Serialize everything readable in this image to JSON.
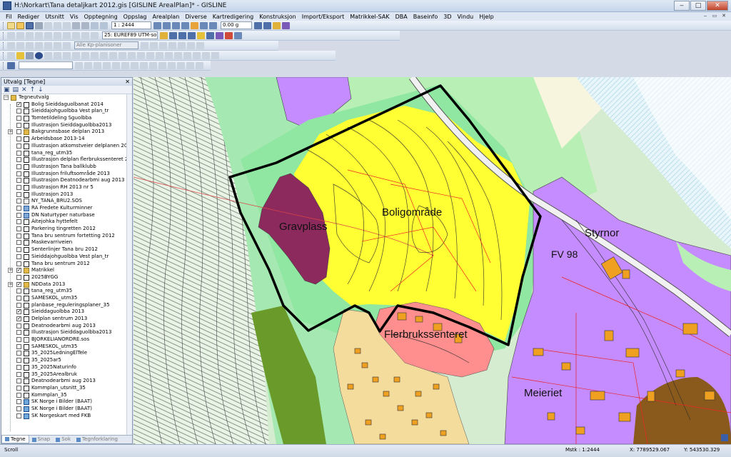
{
  "window": {
    "title": "H:\\Norkart\\Tana detaljkart 2012.gis [GISLINE ArealPlan]* - GISLINE",
    "minimize": "‒",
    "maximize": "□",
    "close": "✕"
  },
  "menu": [
    "Fil",
    "Rediger",
    "Utsnitt",
    "Vis",
    "Opptegning",
    "Oppslag",
    "Arealplan",
    "Diverse",
    "Kartredigering",
    "Konstruksjon",
    "Import/Eksport",
    "Matrikkel-SAK",
    "DBA",
    "Baseinfo",
    "3D",
    "Vindu",
    "Hjelp"
  ],
  "toolbar": {
    "scale": "1 : 2444",
    "coord_system": "25: EUREF89 UTM-sone 35",
    "height_value": "0.00 g",
    "kp_filter": "Alle Kp-planisoner"
  },
  "panel": {
    "title": "Utvalg [Tegne]",
    "close": "✕",
    "root": "Tegneutvalg",
    "layers": [
      {
        "label": "Bolig Sieiddaguolbanat 2014",
        "checked": true,
        "expand": false,
        "icon": "db"
      },
      {
        "label": "Sieiddajohguolbba Vest plan_tr",
        "checked": false,
        "expand": false,
        "icon": "db"
      },
      {
        "label": "Tomtetildeling Sguolbba",
        "checked": false,
        "expand": false,
        "icon": "db"
      },
      {
        "label": "Illustrasjon Sieiddaguolbba2013",
        "checked": false,
        "expand": false,
        "icon": "db"
      },
      {
        "label": "Bakgrunnsbase delplan 2013",
        "checked": false,
        "expand": true,
        "icon": "folder"
      },
      {
        "label": "Arbeidsbase 2013-14",
        "checked": false,
        "expand": false,
        "icon": "db"
      },
      {
        "label": "Illustrasjon atkomstveier delplanen 2013",
        "checked": false,
        "expand": false,
        "icon": "db"
      },
      {
        "label": "tana_reg_utm35",
        "checked": false,
        "expand": false,
        "icon": "db"
      },
      {
        "label": "Illustrasjon delplan flerbrukssenteret 2013",
        "checked": false,
        "expand": false,
        "icon": "db"
      },
      {
        "label": "Illustrasjon Tana ballklubb",
        "checked": false,
        "expand": false,
        "icon": "db"
      },
      {
        "label": "Illustrasjon friluftsområde 2013",
        "checked": false,
        "expand": false,
        "icon": "db"
      },
      {
        "label": "Illustrasjon Deatnodearbmi aug 2013",
        "checked": false,
        "expand": false,
        "icon": "db"
      },
      {
        "label": "Illustrasjon RH 2013 nr 5",
        "checked": false,
        "expand": false,
        "icon": "db"
      },
      {
        "label": "Illustrasjon 2013",
        "checked": false,
        "expand": false,
        "icon": "db"
      },
      {
        "label": "NY_TANA_BRU2.SOS",
        "checked": false,
        "expand": false,
        "icon": "sos"
      },
      {
        "label": "RA Fredete Kulturminner",
        "checked": false,
        "expand": false,
        "icon": "dn"
      },
      {
        "label": "DN Naturtyper naturbase",
        "checked": false,
        "expand": false,
        "icon": "dn"
      },
      {
        "label": "Áitejohka hyttefelt",
        "checked": false,
        "expand": false,
        "icon": "db"
      },
      {
        "label": "Parkering tingretten 2012",
        "checked": false,
        "expand": false,
        "icon": "db"
      },
      {
        "label": "Tana bru sentrum fortetting 2012",
        "checked": false,
        "expand": false,
        "icon": "db"
      },
      {
        "label": "Maskevarriveien",
        "checked": false,
        "expand": false,
        "icon": "db"
      },
      {
        "label": "Senterlinjer Tana bru 2012",
        "checked": false,
        "expand": false,
        "icon": "db"
      },
      {
        "label": "Sieiddajohguolbba Vest plan_tr",
        "checked": false,
        "expand": false,
        "icon": "db"
      },
      {
        "label": "Tana bru sentrum 2012",
        "checked": false,
        "expand": false,
        "icon": "db"
      },
      {
        "label": "Matrikkel",
        "checked": true,
        "expand": true,
        "icon": "folder"
      },
      {
        "label": "2025BYGG",
        "checked": false,
        "expand": false,
        "icon": "db"
      },
      {
        "label": "NDData 2013",
        "checked": true,
        "expand": true,
        "icon": "folder"
      },
      {
        "label": "tana_reg_utm35",
        "checked": false,
        "expand": false,
        "icon": "db"
      },
      {
        "label": "SAMESKOL_utm35",
        "checked": false,
        "expand": false,
        "icon": "db"
      },
      {
        "label": "planbase_reguleringsplaner_35",
        "checked": false,
        "expand": false,
        "icon": "db"
      },
      {
        "label": "Sieiddaguolbba 2013",
        "checked": true,
        "expand": false,
        "icon": "db"
      },
      {
        "label": "Delplan sentrum 2013",
        "checked": true,
        "expand": false,
        "icon": "db"
      },
      {
        "label": "Deatnodearbmi aug 2013",
        "checked": false,
        "expand": false,
        "icon": "db"
      },
      {
        "label": "Illustrasjon Sieiddaguolbba2013",
        "checked": false,
        "expand": false,
        "icon": "db"
      },
      {
        "label": "BJORKELIANORDRE.sos",
        "checked": false,
        "expand": false,
        "icon": "sos"
      },
      {
        "label": "SAMESKOL_utm35",
        "checked": false,
        "expand": false,
        "icon": "db"
      },
      {
        "label": "35_2025LedningElTele",
        "checked": false,
        "expand": false,
        "icon": "db"
      },
      {
        "label": "35_2025ar5",
        "checked": false,
        "expand": false,
        "icon": "db"
      },
      {
        "label": "35_2025Naturinfo",
        "checked": false,
        "expand": false,
        "icon": "db"
      },
      {
        "label": "35_2025Arealbruk",
        "checked": false,
        "expand": false,
        "icon": "db"
      },
      {
        "label": "Deatnodearbmi aug 2013",
        "checked": false,
        "expand": false,
        "icon": "db"
      },
      {
        "label": "Kommplan_utsnitt_35",
        "checked": false,
        "expand": false,
        "icon": "db"
      },
      {
        "label": "Kommplan_35",
        "checked": false,
        "expand": false,
        "icon": "db"
      },
      {
        "label": "SK Norge i Bilder (BAAT)",
        "checked": false,
        "expand": false,
        "icon": "globe"
      },
      {
        "label": "SK Norge i Bilder (BAAT)",
        "checked": false,
        "expand": false,
        "icon": "globe"
      },
      {
        "label": "SK Norgeskart med FKB",
        "checked": false,
        "expand": false,
        "icon": "globe"
      }
    ],
    "tabs": [
      "Tegne",
      "Snap",
      "Sok",
      "Tegnforklaring"
    ]
  },
  "map": {
    "labels": {
      "gravplass": "Gravplass",
      "boligomrade": "Boligområde",
      "styrnor": "Styrnor",
      "fv98": "FV 98",
      "flerbrukssenteret": "Flerbrukssenteret",
      "meieriet": "Meieriet"
    },
    "colors": {
      "boligomrade": "#ffff33",
      "gravplass": "#8c2a5e",
      "friomrade": "#8fe7a2",
      "naering": "#c48cff",
      "senter": "#ff8e8e",
      "eksisterende_bolig": "#f4dc9c",
      "plangrense": "#000000"
    }
  },
  "status": {
    "mode": "Scroll",
    "scale": "Mstk : 1:2444",
    "x": "X: 7789529.067",
    "y": "Y: 543530.329"
  }
}
